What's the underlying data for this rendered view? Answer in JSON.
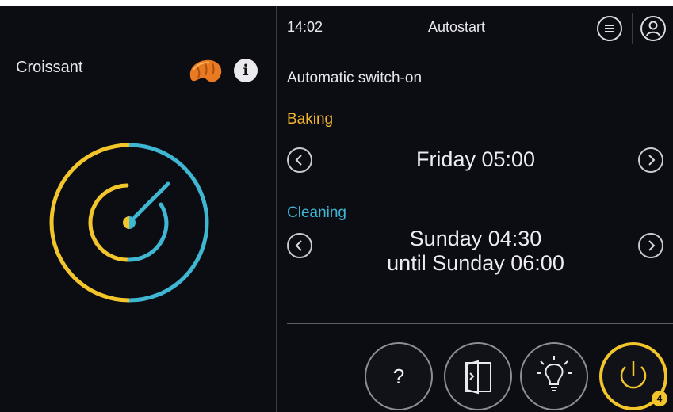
{
  "left": {
    "product_name": "Croissant",
    "product_icon": "croissant-icon",
    "info_icon": "info-icon",
    "info_glyph": "i",
    "dial_colors": {
      "primary": "#f2c52b",
      "secondary": "#3fb7d2"
    }
  },
  "header": {
    "time": "14:02",
    "title": "Autostart",
    "menu_icon": "menu-icon",
    "user_icon": "user-icon"
  },
  "content": {
    "subtitle": "Automatic switch-on",
    "baking": {
      "label": "Baking",
      "value": "Friday 05:00",
      "color": "#f2b42c"
    },
    "cleaning": {
      "label": "Cleaning",
      "value_line1": "Sunday 04:30",
      "value_line2": "until Sunday 06:00",
      "color": "#3fb7d2"
    }
  },
  "bottom_bar": {
    "help_glyph": "?",
    "help_icon": "help-icon",
    "door_icon": "oven-door-icon",
    "light_icon": "light-bulb-icon",
    "power_icon": "power-icon",
    "power_badge": "4",
    "accent": "#f2c52b"
  }
}
